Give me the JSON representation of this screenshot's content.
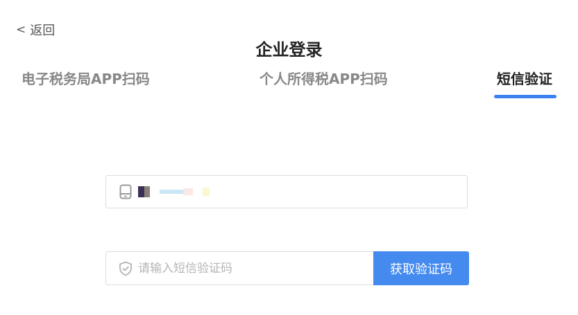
{
  "header": {
    "back_label": "返回",
    "back_chevron": "<",
    "title": "企业登录"
  },
  "tabs": [
    {
      "label": "电子税务局APP扫码",
      "active": false
    },
    {
      "label": "个人所得税APP扫码",
      "active": false
    },
    {
      "label": "短信验证",
      "active": true
    }
  ],
  "form": {
    "phone_icon": "phone-icon",
    "phone_value_masked": true,
    "code_icon": "shield-icon",
    "code_placeholder": "请输入短信验证码",
    "get_code_label": "获取验证码"
  },
  "colors": {
    "accent": "#448aef",
    "tab_underline": "#3b82f0"
  }
}
